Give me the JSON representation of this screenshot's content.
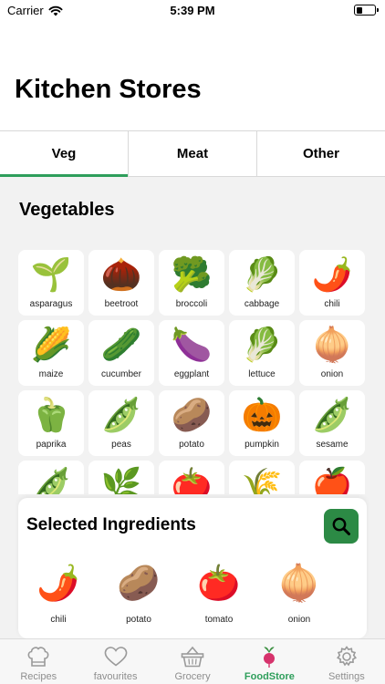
{
  "status": {
    "carrier": "Carrier",
    "time": "5:39 PM"
  },
  "header": {
    "title": "Kitchen Stores"
  },
  "tabs": [
    {
      "label": "Veg",
      "active": true
    },
    {
      "label": "Meat",
      "active": false
    },
    {
      "label": "Other",
      "active": false
    }
  ],
  "section": {
    "title": "Vegetables"
  },
  "vegetables": [
    {
      "label": "asparagus",
      "icon": "🌱"
    },
    {
      "label": "beetroot",
      "icon": "🌰"
    },
    {
      "label": "broccoli",
      "icon": "🥦"
    },
    {
      "label": "cabbage",
      "icon": "🥬"
    },
    {
      "label": "chili",
      "icon": "🌶️"
    },
    {
      "label": "maize",
      "icon": "🌽"
    },
    {
      "label": "cucumber",
      "icon": "🥒"
    },
    {
      "label": "eggplant",
      "icon": "🍆"
    },
    {
      "label": "lettuce",
      "icon": "🥬"
    },
    {
      "label": "onion",
      "icon": "🧅"
    },
    {
      "label": "paprika",
      "icon": "🫑"
    },
    {
      "label": "peas",
      "icon": "🫛"
    },
    {
      "label": "potato",
      "icon": "🥔"
    },
    {
      "label": "pumpkin",
      "icon": "🎃"
    },
    {
      "label": "sesame",
      "icon": "🫛"
    },
    {
      "label": "",
      "icon": "🫛"
    },
    {
      "label": "",
      "icon": "🌿"
    },
    {
      "label": "",
      "icon": "🍅"
    },
    {
      "label": "",
      "icon": "🌾"
    },
    {
      "label": "",
      "icon": "🍎"
    }
  ],
  "selected": {
    "title": "Selected Ingredients",
    "items": [
      {
        "label": "chili",
        "icon": "🌶️"
      },
      {
        "label": "potato",
        "icon": "🥔"
      },
      {
        "label": "tomato",
        "icon": "🍅"
      },
      {
        "label": "onion",
        "icon": "🧅"
      }
    ]
  },
  "tabbar": [
    {
      "label": "Recipes",
      "active": false,
      "icon": "chef-hat-icon"
    },
    {
      "label": "favourites",
      "active": false,
      "icon": "heart-icon"
    },
    {
      "label": "Grocery",
      "active": false,
      "icon": "basket-icon"
    },
    {
      "label": "FoodStore",
      "active": true,
      "icon": "radish-icon"
    },
    {
      "label": "Settings",
      "active": false,
      "icon": "gear-icon"
    }
  ],
  "colors": {
    "accent": "#2e9e5b",
    "search_button": "#2c8a45"
  }
}
